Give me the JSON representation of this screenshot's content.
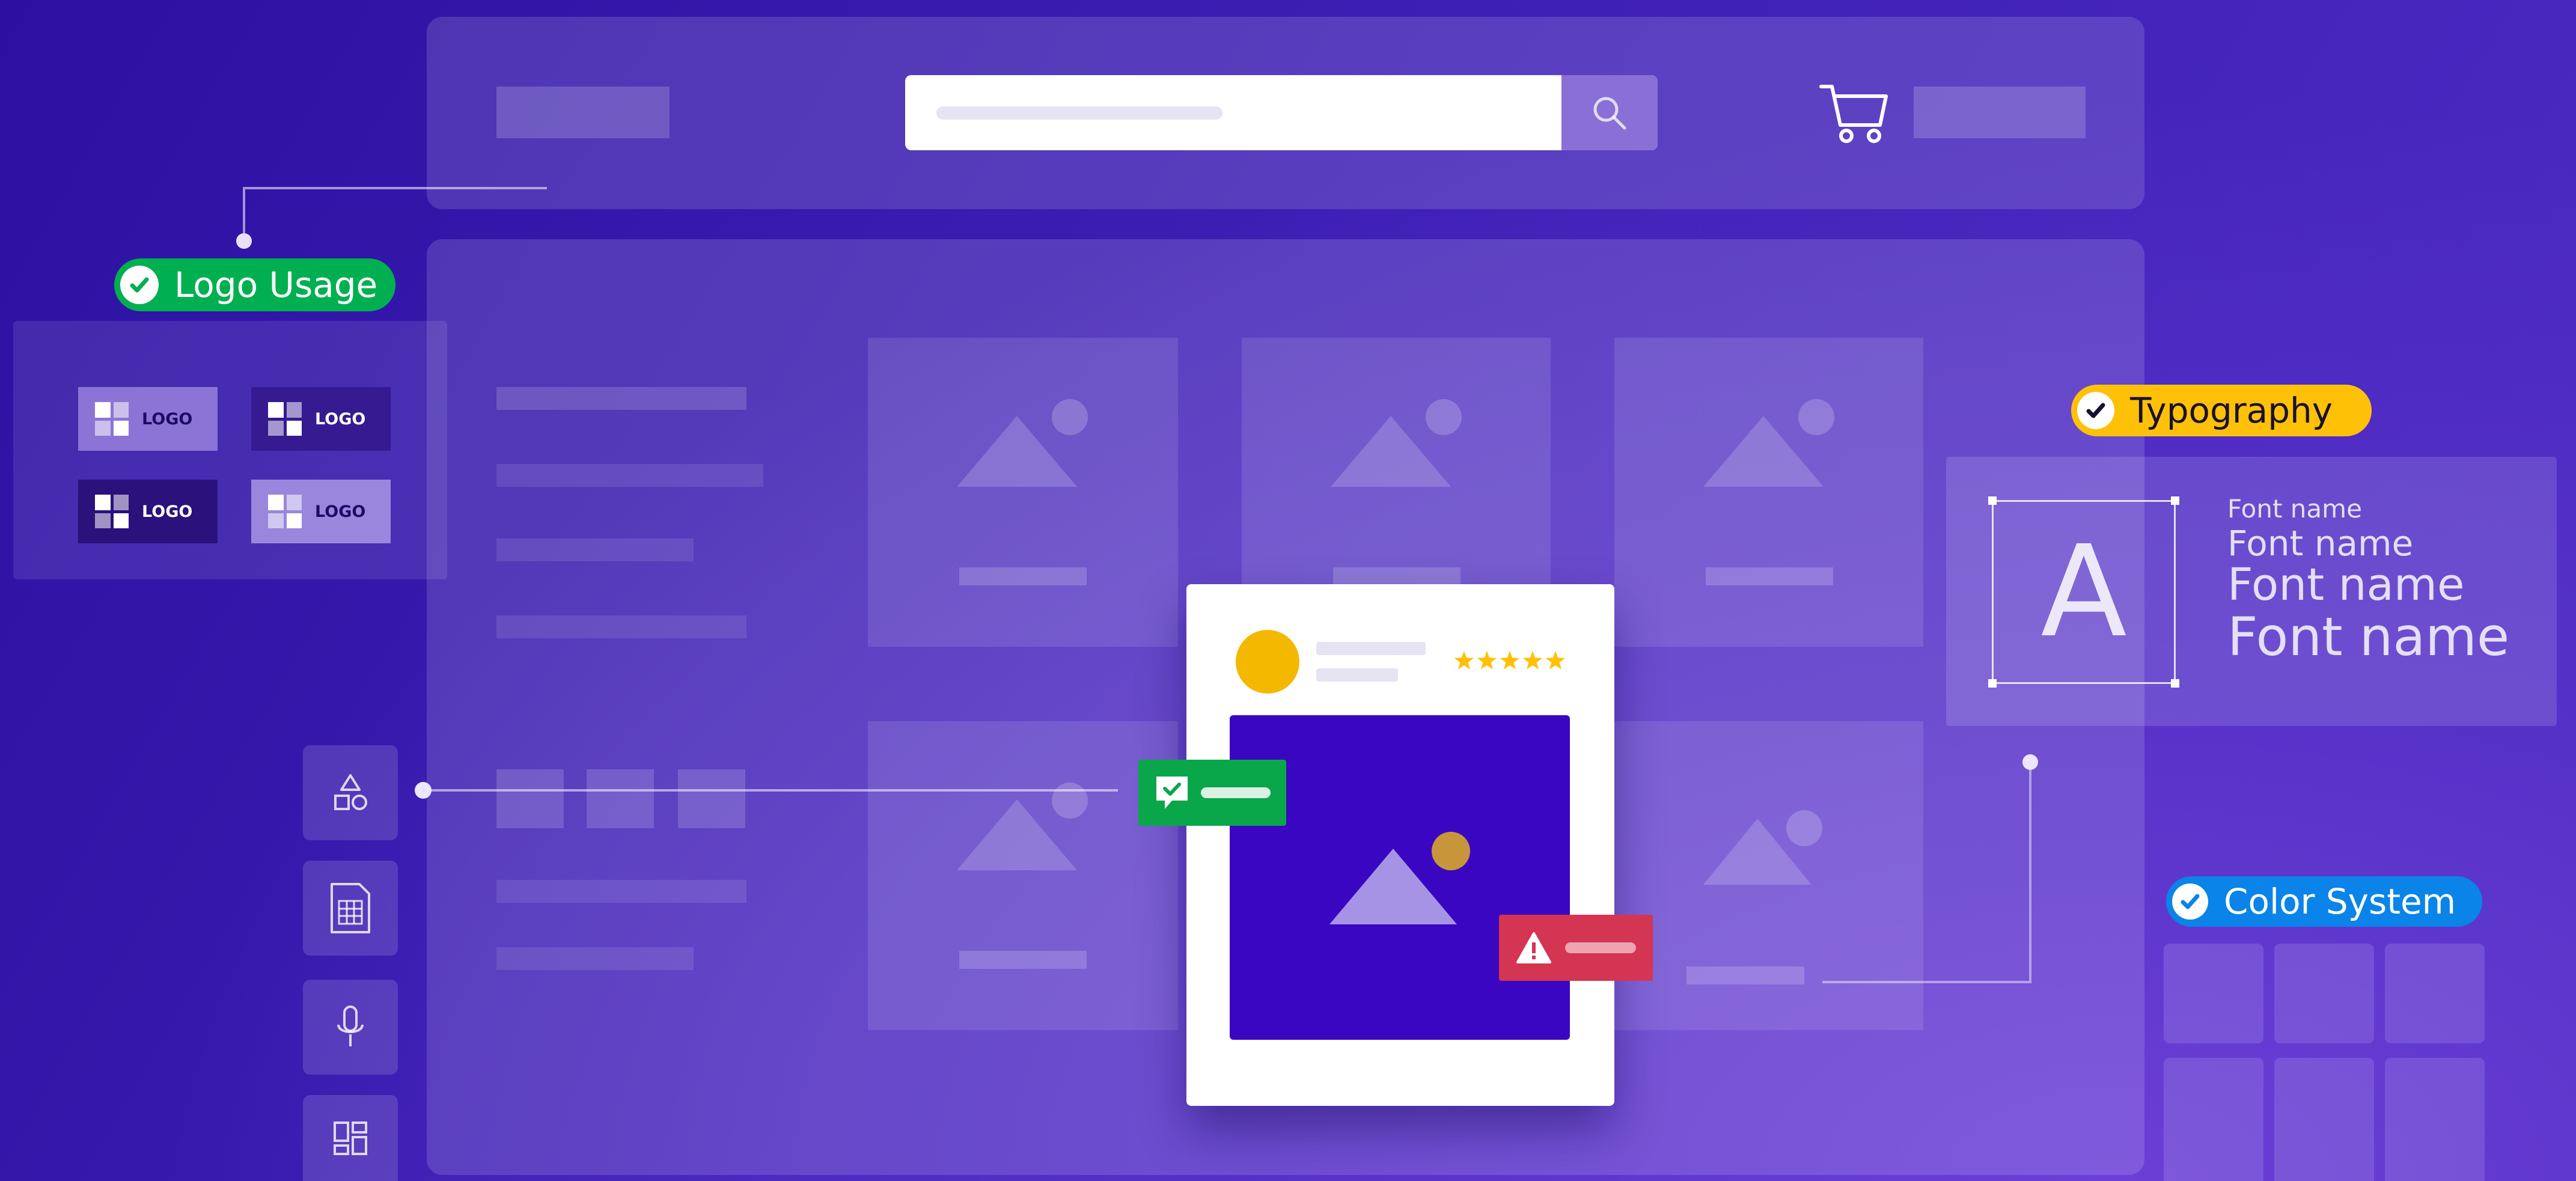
{
  "header": {
    "search": {
      "placeholder": ""
    },
    "icons": [
      "search-icon",
      "cart-icon"
    ]
  },
  "badges": {
    "logo_usage": "Logo Usage",
    "typography": "Typography",
    "color_system": "Color System"
  },
  "logos": [
    {
      "label": "LOGO",
      "variant": "light"
    },
    {
      "label": "LOGO",
      "variant": "dark"
    },
    {
      "label": "LOGO",
      "variant": "dark"
    },
    {
      "label": "LOGO",
      "variant": "light"
    }
  ],
  "typography": {
    "glyph": "A",
    "samples": [
      "Font name",
      "Font name",
      "Font name",
      "Font name"
    ]
  },
  "side_tools": [
    "shapes-icon",
    "spreadsheet-icon",
    "microphone-icon",
    "layout-grid-icon"
  ],
  "product_card": {
    "rating_stars": 5,
    "icons": [
      "chat-check-icon",
      "warning-icon",
      "image-icon"
    ]
  },
  "colors": {
    "background": "#3a1cb0",
    "logo_badge": "#00b050",
    "typography_badge": "#ffc107",
    "color_badge": "#0a84e8",
    "product_image": "#3b06c2",
    "avatar": "#f5b800",
    "stars": "#ffc107",
    "success_toast": "#0aa64a",
    "error_toast": "#d43552",
    "sun": "#c8963a"
  }
}
